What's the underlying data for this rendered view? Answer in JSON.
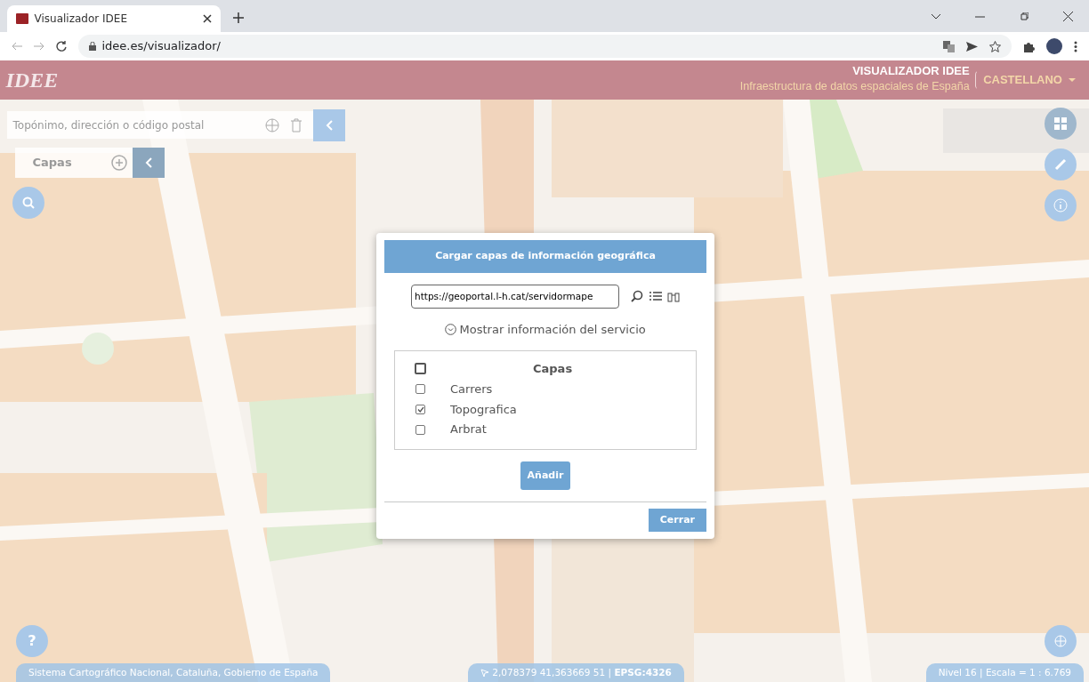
{
  "browser": {
    "tab_title": "Visualizador IDEE",
    "address": "idee.es/visualizador/"
  },
  "header": {
    "logo": "IDEE",
    "title": "VISUALIZADOR **IDEE**",
    "subtitle": "Infraestructura de datos espaciales de España",
    "language": "CASTELLANO"
  },
  "search": {
    "placeholder": "Topónimo, dirección o código postal"
  },
  "layers_panel": {
    "label": "Capas"
  },
  "dialog": {
    "title": "Cargar capas de información geográfica",
    "url": "https://geoportal.l-h.cat/servidormape",
    "info_link": "Mostrar información del servicio",
    "table_header": "Capas",
    "all_checked": false,
    "layers": [
      {
        "name": "Carrers",
        "checked": false
      },
      {
        "name": "Topografica",
        "checked": true
      },
      {
        "name": "Arbrat",
        "checked": false
      }
    ],
    "add_button": "Añadir",
    "close_button": "Cerrar"
  },
  "help_button": "?",
  "footer": {
    "attribution": "Sistema Cartográfico Nacional,  Cataluña, Gobierno de España",
    "coordinates": "2,078379  41,363669  51 | **EPSG:4326**",
    "scale": "Nivel 16 | Escala = 1 : 6.769"
  }
}
